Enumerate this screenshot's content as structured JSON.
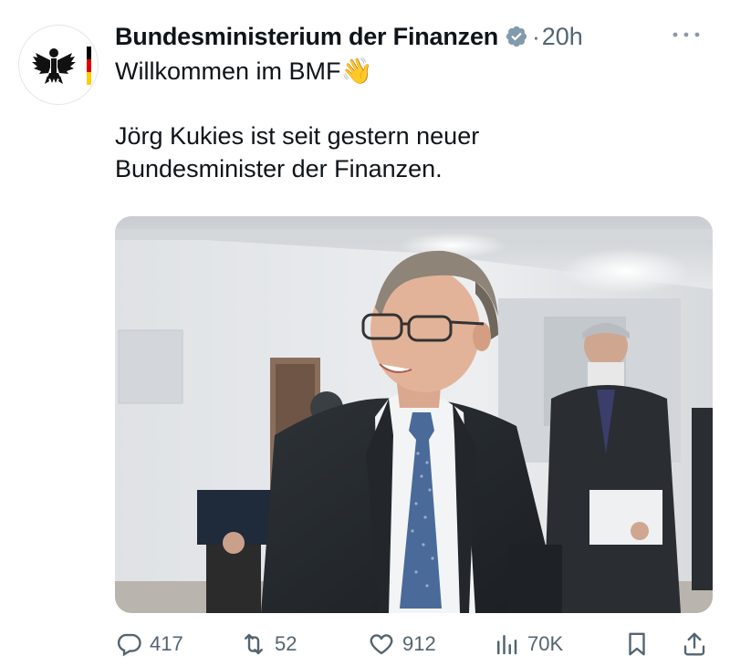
{
  "tweet": {
    "author": "Bundesministerium der Finanzen",
    "separator": "·",
    "time": "20h",
    "text_line1": "Willkommen im BMF",
    "text_line1_emoji": "👋",
    "text_para2_line1": "Jörg Kukies ist seit gestern neuer",
    "text_para2_line2": "Bundesminister der Finanzen.",
    "avatar_icon": "federal-eagle-icon",
    "verified_icon": "verified-badge-icon"
  },
  "actions": {
    "replies": "417",
    "reposts": "52",
    "likes": "912",
    "views": "70K",
    "icons": [
      "reply-icon",
      "repost-icon",
      "like-icon",
      "views-icon",
      "bookmark-icon",
      "share-icon"
    ]
  },
  "colors": {
    "text": "#0f1419",
    "secondary": "#536471",
    "verified": "#829aab",
    "flag_black": "#000000",
    "flag_red": "#dd0000",
    "flag_gold": "#ffce00"
  }
}
